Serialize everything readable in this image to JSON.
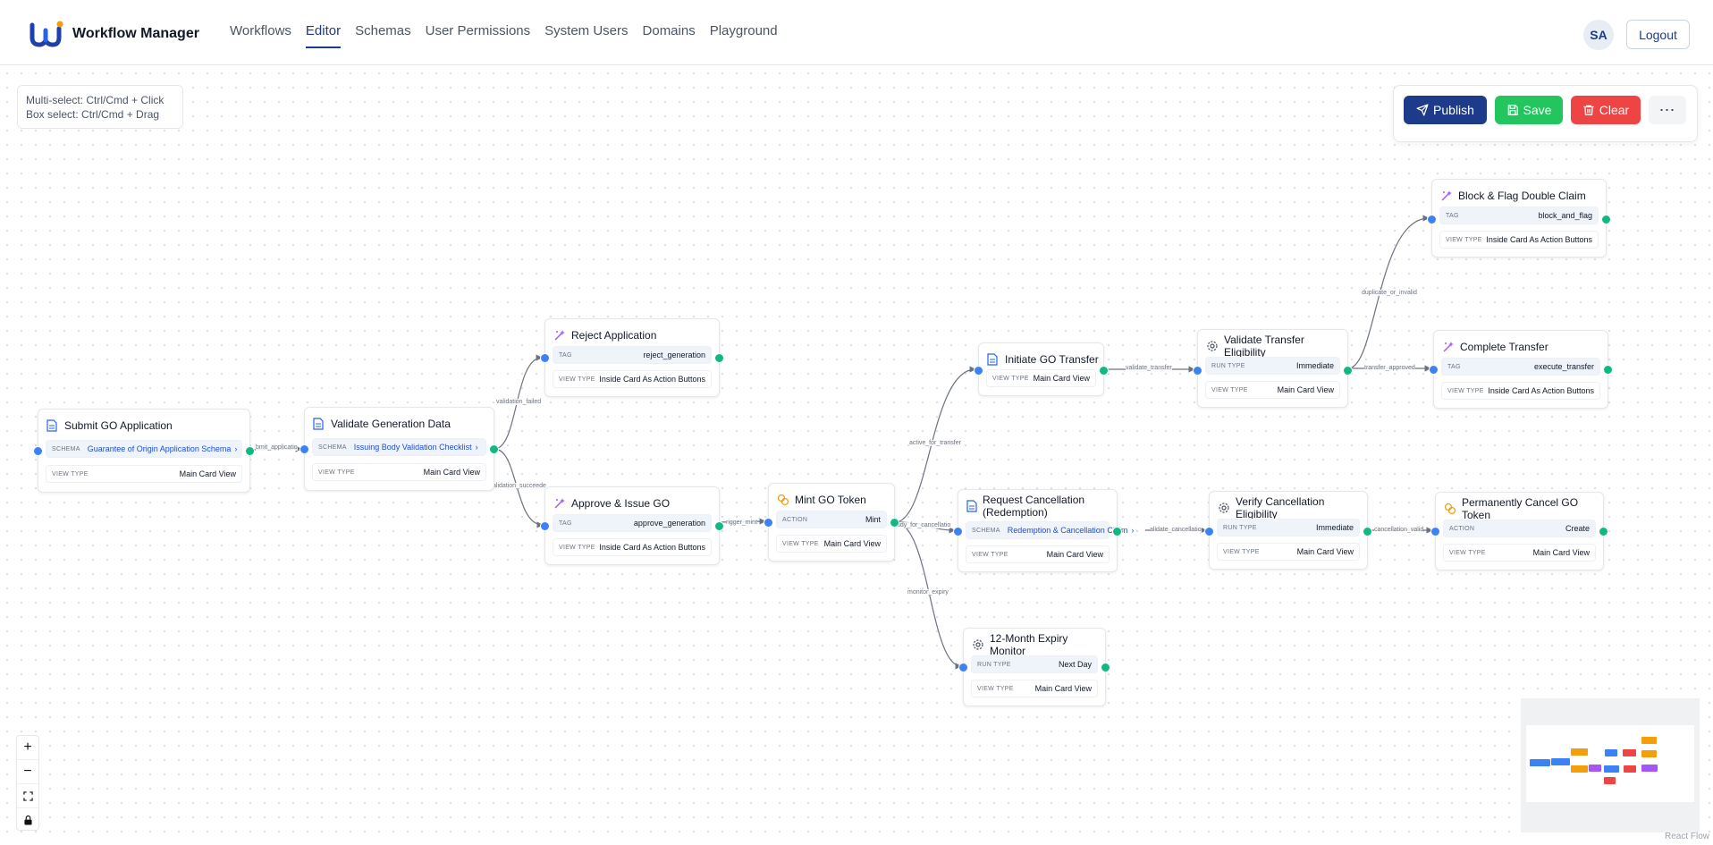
{
  "app": {
    "title": "Workflow Manager",
    "nav": [
      "Workflows",
      "Editor",
      "Schemas",
      "User Permissions",
      "System Users",
      "Domains",
      "Playground"
    ],
    "active_nav": "Editor",
    "avatar_initials": "SA",
    "logout_label": "Logout"
  },
  "hint": {
    "line1": "Multi-select: Ctrl/Cmd + Click",
    "line2": "Box select: Ctrl/Cmd + Drag"
  },
  "toolbar": {
    "publish_label": "Publish",
    "save_label": "Save",
    "clear_label": "Clear",
    "more_label": "⋯"
  },
  "colors": {
    "primary": "#1e3a8a",
    "save": "#22c55e",
    "clear": "#ef4444",
    "handle_in": "#3b82f6",
    "handle_out": "#10b981",
    "icon_document": "#2563eb",
    "icon_sparkle": "#a855f7",
    "icon_coins": "#f59e0b",
    "icon_gear": "#4b5563"
  },
  "nodes": {
    "submit": {
      "title": "Submit GO Application",
      "icon": "document-icon",
      "rows": [
        {
          "key": "SCHEMA",
          "value": "Guarantee of Origin Application Schema"
        },
        {
          "key": "VIEW TYPE",
          "value": "Main Card View"
        }
      ]
    },
    "validate_gen": {
      "title": "Validate Generation Data",
      "icon": "document-icon",
      "rows": [
        {
          "key": "SCHEMA",
          "value": "Issuing Body Validation Checklist"
        },
        {
          "key": "VIEW TYPE",
          "value": "Main Card View"
        }
      ]
    },
    "reject": {
      "title": "Reject Application",
      "icon": "sparkle-icon",
      "rows": [
        {
          "key": "TAG",
          "value": "reject_generation"
        },
        {
          "key": "VIEW TYPE",
          "value": "Inside Card As Action Buttons"
        }
      ]
    },
    "approve": {
      "title": "Approve & Issue GO",
      "icon": "sparkle-icon",
      "rows": [
        {
          "key": "TAG",
          "value": "approve_generation"
        },
        {
          "key": "VIEW TYPE",
          "value": "Inside Card As Action Buttons"
        }
      ]
    },
    "mint": {
      "title": "Mint GO Token",
      "icon": "coins-icon",
      "rows": [
        {
          "key": "ACTION",
          "value": "Mint"
        },
        {
          "key": "VIEW TYPE",
          "value": "Main Card View"
        }
      ]
    },
    "initiate_transfer": {
      "title": "Initiate GO Transfer",
      "icon": "document-icon",
      "rows": [
        {
          "key": "VIEW TYPE",
          "value": "Main Card View"
        }
      ]
    },
    "validate_transfer": {
      "title": "Validate Transfer Eligibility",
      "icon": "gear-icon",
      "rows": [
        {
          "key": "RUN TYPE",
          "value": "Immediate"
        },
        {
          "key": "VIEW TYPE",
          "value": "Main Card View"
        }
      ]
    },
    "block_flag": {
      "title": "Block & Flag Double Claim",
      "icon": "sparkle-icon",
      "rows": [
        {
          "key": "TAG",
          "value": "block_and_flag"
        },
        {
          "key": "VIEW TYPE",
          "value": "Inside Card As Action Buttons"
        }
      ]
    },
    "complete_transfer": {
      "title": "Complete Transfer",
      "icon": "sparkle-icon",
      "rows": [
        {
          "key": "TAG",
          "value": "execute_transfer"
        },
        {
          "key": "VIEW TYPE",
          "value": "Inside Card As Action Buttons"
        }
      ]
    },
    "request_cancel": {
      "title": "Request Cancellation (Redemption)",
      "icon": "document-icon",
      "rows": [
        {
          "key": "SCHEMA",
          "value": "Redemption & Cancellation Claim"
        },
        {
          "key": "VIEW TYPE",
          "value": "Main Card View"
        }
      ]
    },
    "verify_cancel": {
      "title": "Verify Cancellation Eligibility",
      "icon": "gear-icon",
      "rows": [
        {
          "key": "RUN TYPE",
          "value": "Immediate"
        },
        {
          "key": "VIEW TYPE",
          "value": "Main Card View"
        }
      ]
    },
    "perm_cancel": {
      "title": "Permanently Cancel GO Token",
      "icon": "coins-icon",
      "rows": [
        {
          "key": "ACTION",
          "value": "Create"
        },
        {
          "key": "VIEW TYPE",
          "value": "Main Card View"
        }
      ]
    },
    "expiry": {
      "title": "12-Month Expiry Monitor",
      "icon": "gear-icon",
      "rows": [
        {
          "key": "RUN TYPE",
          "value": "Next Day"
        },
        {
          "key": "VIEW TYPE",
          "value": "Main Card View"
        }
      ]
    }
  },
  "edge_labels": {
    "submit_application": "bmit_applicatio",
    "validation_failed": "validation_failed",
    "validation_succeeded": "alidation_succeede",
    "trigger_mint": "rigger_mint",
    "active_for_transfer": "active_for_transfer",
    "ready_for_cancellation": "ady_for_cancellatio",
    "monitor_expiry": "monitor_expiry",
    "validate_transfer": "validate_transfer",
    "duplicate_or_invalid": "duplicate_or_invalid",
    "transfer_approved": "transfer_approved",
    "validate_cancellation": "alidate_cancellatio",
    "cancellation_valid": "cancellation_valid"
  },
  "controls": {
    "zoom_in": "+",
    "zoom_out": "−",
    "fit_view": "fit-view-icon",
    "lock": "lock-icon"
  },
  "minimap_colors": [
    "#3b82f6",
    "#f59e0b",
    "#a855f7",
    "#ef4444"
  ],
  "attribution": "React Flow"
}
